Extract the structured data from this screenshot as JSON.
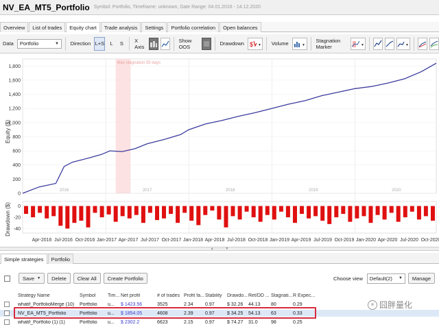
{
  "window": {
    "title": "NV_EA_MT5_Portfolio",
    "subtitle": "Symbol: Portfolio, Timeframe: unknown, Date Range: 04.01.2016 - 14.12.2020"
  },
  "tabs": [
    {
      "label": "Overview",
      "active": false
    },
    {
      "label": "List of trades",
      "active": false
    },
    {
      "label": "Equity chart",
      "active": true
    },
    {
      "label": "Trade analysis",
      "active": false
    },
    {
      "label": "Settings",
      "active": false
    },
    {
      "label": "Portfolio correlation",
      "active": false
    },
    {
      "label": "Open balances",
      "active": false
    }
  ],
  "toolbar": {
    "data_label": "Data",
    "data_value": "Portfolio",
    "direction_label": "Direction",
    "direction_options": [
      "L+S",
      "L",
      "S"
    ],
    "xaxis_label": "X Axis",
    "showoos_label": "Show OOS",
    "drawdown_label": "Drawdown",
    "volume_label": "Volume",
    "stagnation_label": "Stagnation Marker"
  },
  "chart": {
    "stagnation_label": "Max stagnation 55 days",
    "equity_axis_label": "Equity ($)",
    "drawdown_axis_label": "Drawdown ($)",
    "year_labels": [
      "2016",
      "2017",
      "2018",
      "2019",
      "2020"
    ]
  },
  "chart_data": [
    {
      "type": "line",
      "title": "",
      "ylabel": "Equity ($)",
      "ylim": [
        0,
        1900
      ],
      "yticks": [
        0,
        200,
        400,
        600,
        800,
        1000,
        1200,
        1400,
        1600,
        1800
      ],
      "xlim": [
        2016.0,
        2020.98
      ],
      "x": [
        2016.0,
        2016.2,
        2016.4,
        2016.5,
        2016.6,
        2016.8,
        2016.95,
        2017.05,
        2017.2,
        2017.35,
        2017.5,
        2017.7,
        2017.9,
        2018.0,
        2018.2,
        2018.4,
        2018.6,
        2018.8,
        2019.0,
        2019.2,
        2019.4,
        2019.6,
        2019.8,
        2020.0,
        2020.2,
        2020.4,
        2020.6,
        2020.8,
        2020.98
      ],
      "series": [
        {
          "name": "",
          "color": "#3b3b9e",
          "values": [
            0,
            90,
            140,
            380,
            440,
            500,
            550,
            600,
            590,
            630,
            700,
            760,
            830,
            900,
            980,
            1030,
            1090,
            1140,
            1200,
            1260,
            1310,
            1380,
            1430,
            1480,
            1510,
            1560,
            1620,
            1720,
            1840
          ]
        }
      ],
      "stagnation_x": [
        2017.12,
        2017.3
      ],
      "grid": true
    },
    {
      "type": "bar",
      "title": "",
      "ylabel": "Drawdown ($)",
      "ylim": [
        -48,
        8
      ],
      "yticks": [
        0,
        -20,
        -40
      ],
      "categories": [
        "Apr-2016",
        "Jul-2016",
        "Oct-2016",
        "Jan-2017",
        "Apr-2017",
        "Jul-2017",
        "Oct-2017",
        "Jan-2018",
        "Apr-2018",
        "Jul-2018",
        "Oct-2018",
        "Jan-2019",
        "Apr-2019",
        "Jul-2019",
        "Oct-2019",
        "Jan-2020",
        "Apr-2020",
        "Jul-2020",
        "Oct-2020"
      ],
      "color": "#e01010",
      "values": [
        -14,
        -20,
        -12,
        -22,
        -18,
        -35,
        -40,
        -30,
        -26,
        -38,
        -12,
        -20,
        -15,
        -28,
        -18,
        -22,
        -16,
        -30,
        -12,
        -25,
        -22,
        -14,
        -30,
        -12,
        -26,
        -34,
        -16,
        -8,
        -24,
        -38,
        -18,
        -24,
        -10,
        -20,
        -28,
        -16,
        -24,
        -10,
        -20,
        -30,
        -14,
        -22,
        -18,
        -26,
        -32,
        -20,
        -14,
        -28,
        -22,
        -18,
        -30,
        -16,
        -24,
        -12,
        -28,
        -20,
        -10,
        -24,
        -18,
        -26
      ]
    }
  ],
  "bottom_tabs": [
    {
      "label": "Simple strategies",
      "active": true
    },
    {
      "label": "Portfolio",
      "active": false
    }
  ],
  "bottom_toolbar": {
    "save_label": "Save",
    "delete_label": "Delete",
    "clear_all_label": "Clear All",
    "create_portfolio_label": "Create Portfolio",
    "choose_view_label": "Choose view",
    "view_value": "Default(2)",
    "manage_label": "Manage"
  },
  "table": {
    "columns": [
      "Strategy Name",
      "Symbol",
      "Tim...",
      "Net profit",
      "# of trades",
      "Profit fa...",
      "Stability",
      "Drawdo...",
      "Ret/DD ...",
      "Stagnati...",
      "R Expec..."
    ],
    "rows": [
      [
        "whatif_PortfolioMerge (10)",
        "Portfolio",
        "u...",
        "$ 1423.56",
        "3525",
        "2.34",
        "0.97",
        "$ 32.26",
        "44.13",
        "80",
        "0.29"
      ],
      [
        "NV_EA_MT5_Portfolio",
        "Portfolio",
        "u...",
        "$ 1854.05",
        "4608",
        "2.39",
        "0.97",
        "$ 34.25",
        "54.13",
        "63",
        "0.33"
      ],
      [
        "whatif_Portfolio (1) (1)",
        "Portfolio",
        "u...",
        "$ 2302.2",
        "6623",
        "2.15",
        "0.97",
        "$ 74.27",
        "31.0",
        "98",
        "0.25"
      ]
    ]
  },
  "watermark": "囧胖量化"
}
